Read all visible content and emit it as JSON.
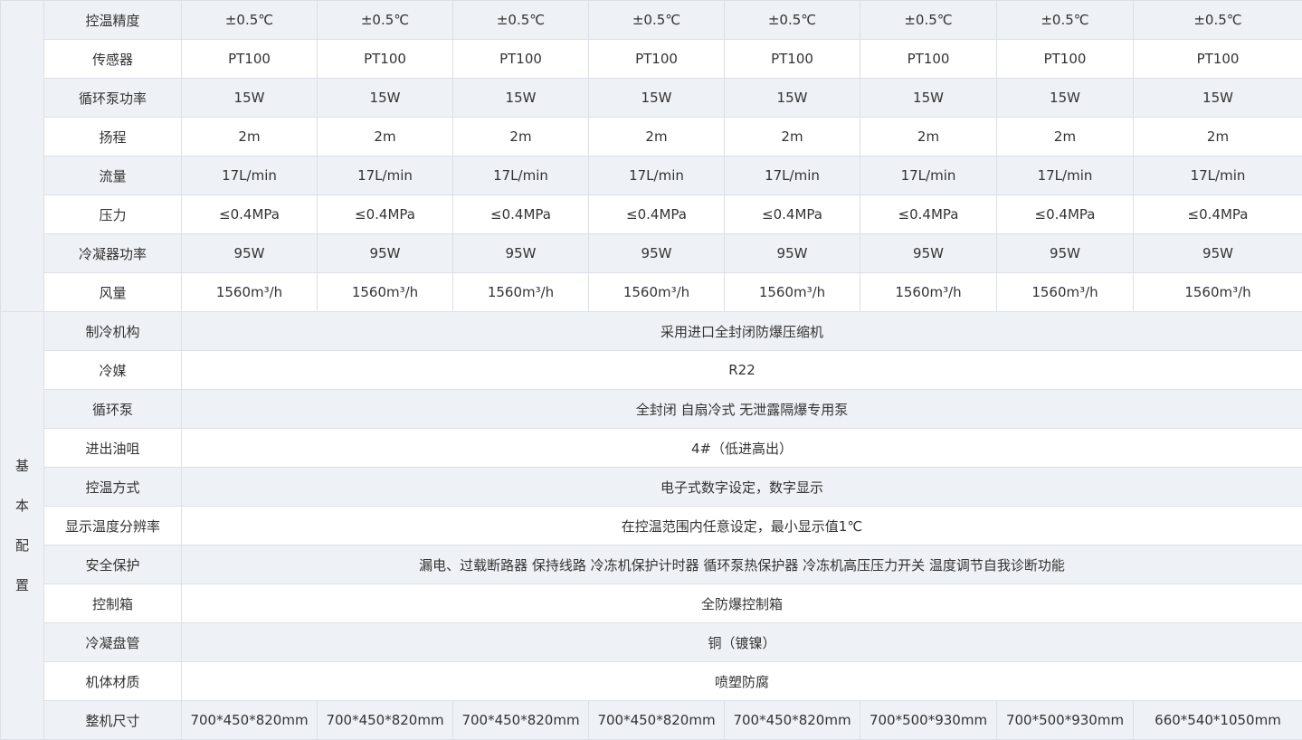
{
  "spec_rows": [
    {
      "label": "控温精度",
      "values": [
        "±0.5℃",
        "±0.5℃",
        "±0.5℃",
        "±0.5℃",
        "±0.5℃",
        "±0.5℃",
        "±0.5℃",
        "±0.5℃"
      ]
    },
    {
      "label": "传感器",
      "values": [
        "PT100",
        "PT100",
        "PT100",
        "PT100",
        "PT100",
        "PT100",
        "PT100",
        "PT100"
      ]
    },
    {
      "label": "循环泵功率",
      "values": [
        "15W",
        "15W",
        "15W",
        "15W",
        "15W",
        "15W",
        "15W",
        "15W"
      ]
    },
    {
      "label": "扬程",
      "values": [
        "2m",
        "2m",
        "2m",
        "2m",
        "2m",
        "2m",
        "2m",
        "2m"
      ]
    },
    {
      "label": "流量",
      "values": [
        "17L/min",
        "17L/min",
        "17L/min",
        "17L/min",
        "17L/min",
        "17L/min",
        "17L/min",
        "17L/min"
      ]
    },
    {
      "label": "压力",
      "values": [
        "≤0.4MPa",
        "≤0.4MPa",
        "≤0.4MPa",
        "≤0.4MPa",
        "≤0.4MPa",
        "≤0.4MPa",
        "≤0.4MPa",
        "≤0.4MPa"
      ]
    },
    {
      "label": "冷凝器功率",
      "values": [
        "95W",
        "95W",
        "95W",
        "95W",
        "95W",
        "95W",
        "95W",
        "95W"
      ]
    },
    {
      "label": "风量",
      "values": [
        "1560m³/h",
        "1560m³/h",
        "1560m³/h",
        "1560m³/h",
        "1560m³/h",
        "1560m³/h",
        "1560m³/h",
        "1560m³/h"
      ]
    }
  ],
  "basic_group_label": "基本配置",
  "basic_rows": [
    {
      "label": "制冷机构",
      "value": "采用进口全封闭防爆压缩机"
    },
    {
      "label": "冷媒",
      "value": "R22"
    },
    {
      "label": "循环泵",
      "value": "全封闭 自扇冷式 无泄露隔爆专用泵"
    },
    {
      "label": "进出油咀",
      "value": "4#（低进高出）"
    },
    {
      "label": "控温方式",
      "value": "电子式数字设定，数字显示"
    },
    {
      "label": "显示温度分辨率",
      "value": "在控温范围内任意设定，最小显示值1℃"
    },
    {
      "label": "安全保护",
      "value": "漏电、过载断路器 保持线路 冷冻机保护计时器 循环泵热保护器  冷冻机高压压力开关 温度调节自我诊断功能"
    },
    {
      "label": "控制箱",
      "value": "全防爆控制箱"
    },
    {
      "label": "冷凝盘管",
      "value": "铜（镀镍）"
    },
    {
      "label": "机体材质",
      "value": "喷塑防腐"
    }
  ],
  "size_row": {
    "label": "整机尺寸",
    "values": [
      "700*450*820mm",
      "700*450*820mm",
      "700*450*820mm",
      "700*450*820mm",
      "700*450*820mm",
      "700*500*930mm",
      "700*500*930mm",
      "660*540*1050mm"
    ]
  }
}
